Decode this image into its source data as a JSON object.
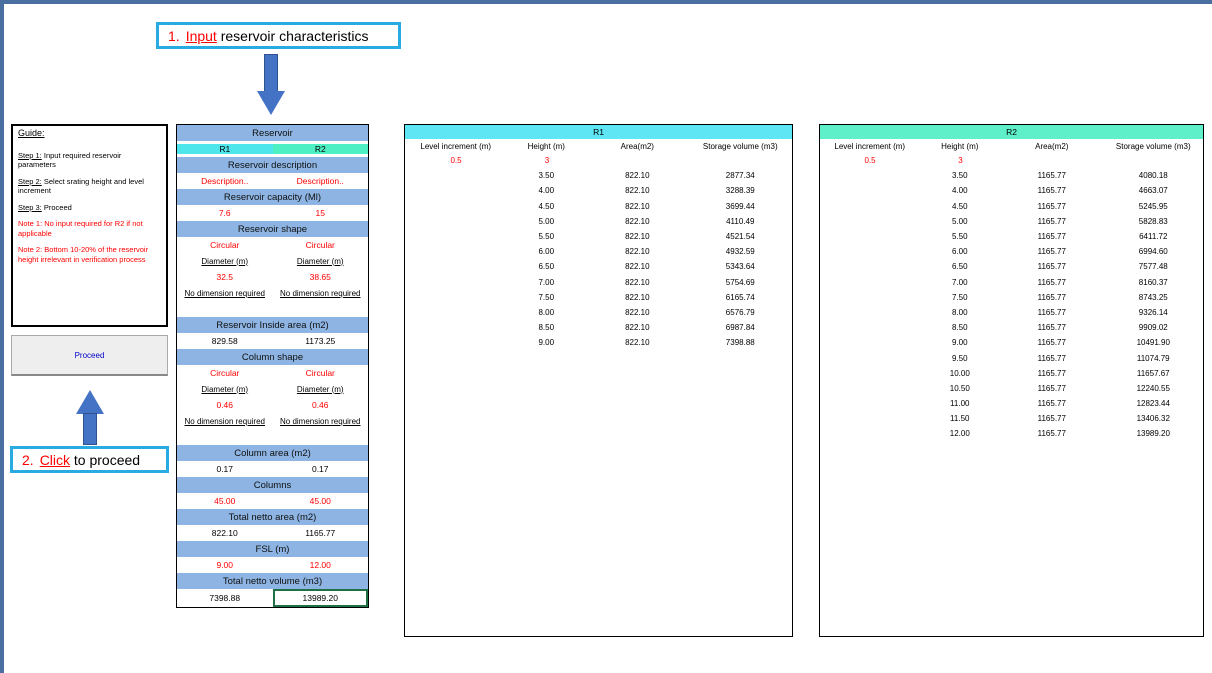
{
  "callout1": {
    "number": "1.",
    "key": "Input",
    "rest": " reservoir characteristics"
  },
  "callout2": {
    "number": "2.",
    "key": "Click",
    "rest": " to proceed"
  },
  "guide": {
    "title": "Guide:",
    "step1_label": "Step 1:",
    "step1_text": " Input required reservoir parameters",
    "step2_label": "Step 2:",
    "step2_text": " Select srating height and level increment",
    "step3_label": "Step 3:",
    "step3_text": " Proceed",
    "note1": "Note 1: No input required for R2 if not applicable",
    "note2": "Note 2: Bottom 10-20% of the reservoir height irrelevant in verification process"
  },
  "proceed_label": "Proceed",
  "reservoir": {
    "title": "Reservoir",
    "r1": "R1",
    "r2": "R2",
    "desc_hdr": "Reservoir description",
    "desc": [
      "Description..",
      "Description.."
    ],
    "capacity_hdr": "Reservoir capacity (Ml)",
    "capacity": [
      "7.6",
      "15"
    ],
    "shape_hdr": "Reservoir shape",
    "shape": [
      "Circular",
      "Circular"
    ],
    "dim_label": [
      "Diameter (m)",
      "Diameter (m)"
    ],
    "dim_value": [
      "32.5",
      "38.65"
    ],
    "no_dim": [
      "No dimension required",
      "No dimension required"
    ],
    "inside_hdr": "Reservoir Inside area (m2)",
    "inside": [
      "829.58",
      "1173.25"
    ],
    "col_shape_hdr": "Column shape",
    "col_shape": [
      "Circular",
      "Circular"
    ],
    "col_dim_label": [
      "Diameter (m)",
      "Diameter (m)"
    ],
    "col_dim_value": [
      "0.46",
      "0.46"
    ],
    "col_no_dim": [
      "No dimension required",
      "No dimension required"
    ],
    "col_area_hdr": "Column area (m2)",
    "col_area": [
      "0.17",
      "0.17"
    ],
    "columns_hdr": "Columns",
    "columns": [
      "45.00",
      "45.00"
    ],
    "netto_area_hdr": "Total netto area (m2)",
    "netto_area": [
      "822.10",
      "1165.77"
    ],
    "fsl_hdr": "FSL (m)",
    "fsl": [
      "9.00",
      "12.00"
    ],
    "netto_vol_hdr": "Total netto volume (m3)",
    "netto_vol": [
      "7398.88",
      "13989.20"
    ]
  },
  "table_r1": {
    "title": "R1",
    "headers": [
      "Level increment (m)",
      "Height (m)",
      "Area(m2)",
      "Storage volume (m3)"
    ],
    "increment": "0.5",
    "start_height": "3",
    "rows": [
      [
        "3.50",
        "822.10",
        "2877.34"
      ],
      [
        "4.00",
        "822.10",
        "3288.39"
      ],
      [
        "4.50",
        "822.10",
        "3699.44"
      ],
      [
        "5.00",
        "822.10",
        "4110.49"
      ],
      [
        "5.50",
        "822.10",
        "4521.54"
      ],
      [
        "6.00",
        "822.10",
        "4932.59"
      ],
      [
        "6.50",
        "822.10",
        "5343.64"
      ],
      [
        "7.00",
        "822.10",
        "5754.69"
      ],
      [
        "7.50",
        "822.10",
        "6165.74"
      ],
      [
        "8.00",
        "822.10",
        "6576.79"
      ],
      [
        "8.50",
        "822.10",
        "6987.84"
      ],
      [
        "9.00",
        "822.10",
        "7398.88"
      ]
    ]
  },
  "table_r2": {
    "title": "R2",
    "headers": [
      "Level increment (m)",
      "Height (m)",
      "Area(m2)",
      "Storage volume (m3)"
    ],
    "increment": "0.5",
    "start_height": "3",
    "rows": [
      [
        "3.50",
        "1165.77",
        "4080.18"
      ],
      [
        "4.00",
        "1165.77",
        "4663.07"
      ],
      [
        "4.50",
        "1165.77",
        "5245.95"
      ],
      [
        "5.00",
        "1165.77",
        "5828.83"
      ],
      [
        "5.50",
        "1165.77",
        "6411.72"
      ],
      [
        "6.00",
        "1165.77",
        "6994.60"
      ],
      [
        "6.50",
        "1165.77",
        "7577.48"
      ],
      [
        "7.00",
        "1165.77",
        "8160.37"
      ],
      [
        "7.50",
        "1165.77",
        "8743.25"
      ],
      [
        "8.00",
        "1165.77",
        "9326.14"
      ],
      [
        "8.50",
        "1165.77",
        "9909.02"
      ],
      [
        "9.00",
        "1165.77",
        "10491.90"
      ],
      [
        "9.50",
        "1165.77",
        "11074.79"
      ],
      [
        "10.00",
        "1165.77",
        "11657.67"
      ],
      [
        "10.50",
        "1165.77",
        "12240.55"
      ],
      [
        "11.00",
        "1165.77",
        "12823.44"
      ],
      [
        "11.50",
        "1165.77",
        "13406.32"
      ],
      [
        "12.00",
        "1165.77",
        "13989.20"
      ]
    ]
  }
}
